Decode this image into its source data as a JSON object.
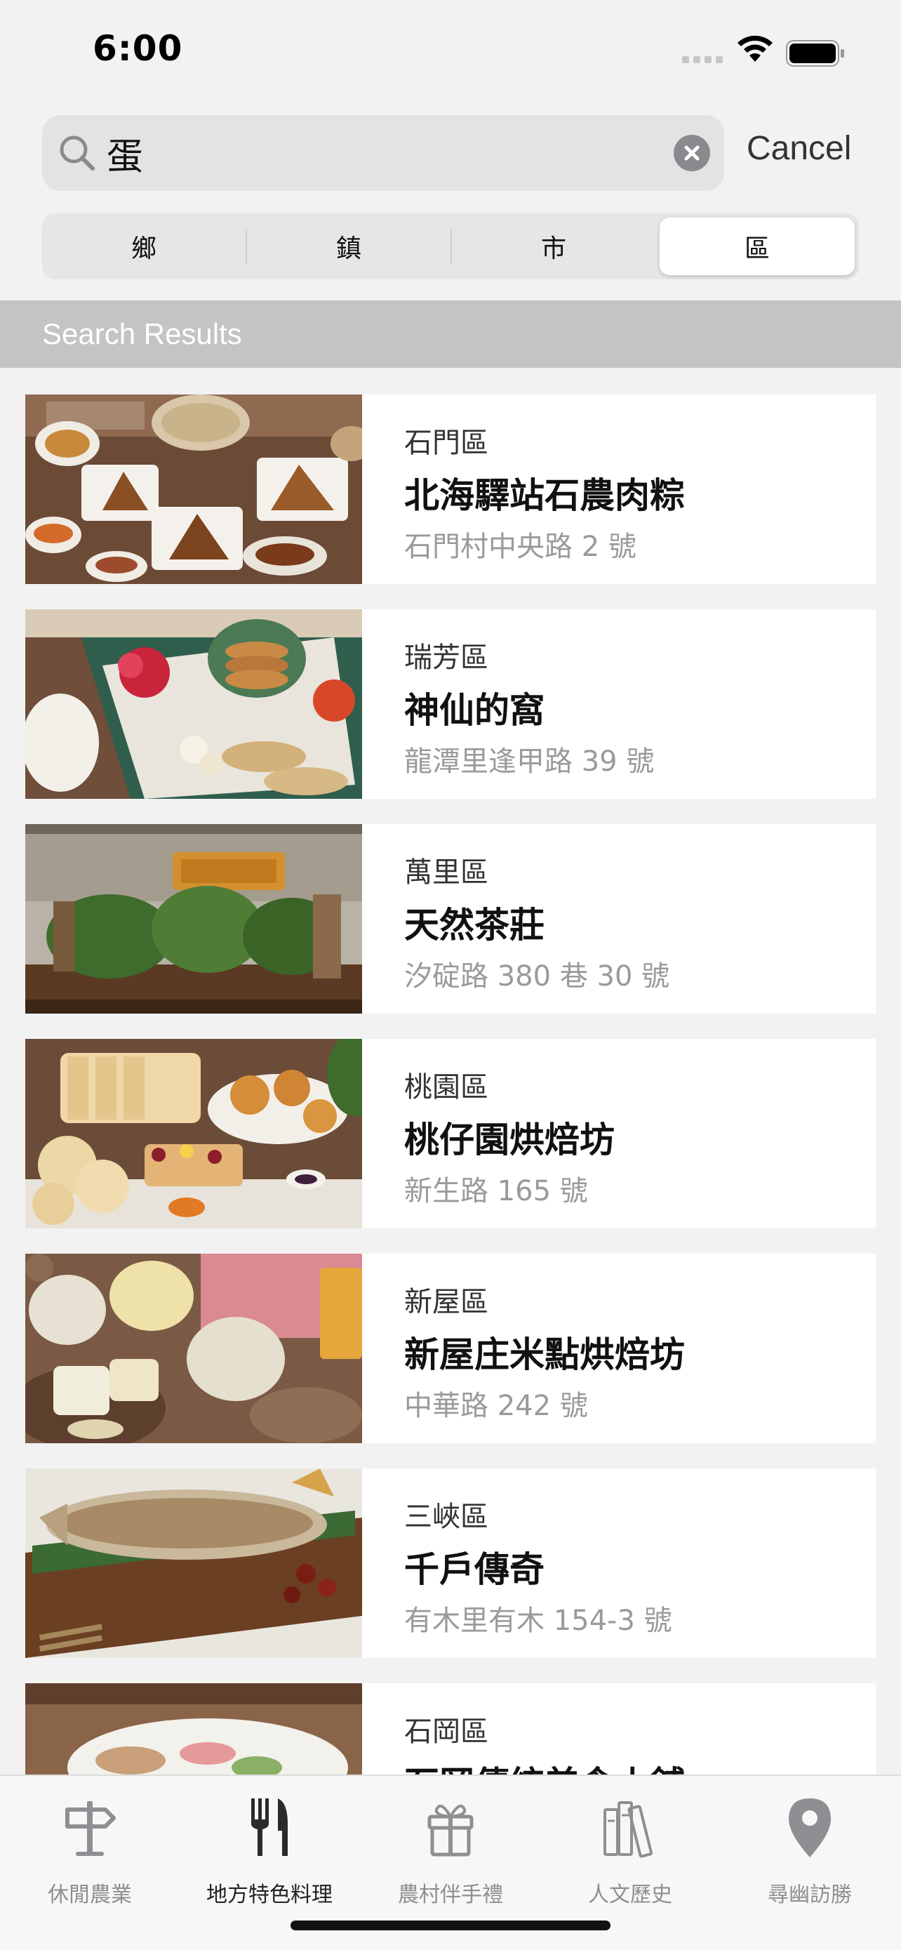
{
  "status_bar": {
    "time": "6:00"
  },
  "search": {
    "query": "蛋",
    "cancel_label": "Cancel"
  },
  "segments": [
    {
      "label": "鄉",
      "selected": false
    },
    {
      "label": "鎮",
      "selected": false
    },
    {
      "label": "市",
      "selected": false
    },
    {
      "label": "區",
      "selected": true
    }
  ],
  "results_header": "Search Results",
  "results": [
    {
      "district": "石門區",
      "name": "北海驛站石農肉粽",
      "address": "石門村中央路 2 號"
    },
    {
      "district": "瑞芳區",
      "name": "神仙的窩",
      "address": "龍潭里逢甲路 39 號"
    },
    {
      "district": "萬里區",
      "name": "天然茶莊",
      "address": "汐碇路 380 巷 30 號"
    },
    {
      "district": "桃園區",
      "name": "桃仔園烘焙坊",
      "address": "新生路 165 號"
    },
    {
      "district": "新屋區",
      "name": "新屋庄米點烘焙坊",
      "address": "中華路 242 號"
    },
    {
      "district": "三峽區",
      "name": "千戶傳奇",
      "address": "有木里有木 154-3 號"
    },
    {
      "district": "石岡區",
      "name": "石岡傳統美食小舖",
      "address": ""
    }
  ],
  "tabs": [
    {
      "label": "休閒農業",
      "icon": "signpost-icon",
      "active": false
    },
    {
      "label": "地方特色料理",
      "icon": "fork-knife-icon",
      "active": true
    },
    {
      "label": "農村伴手禮",
      "icon": "gift-icon",
      "active": false
    },
    {
      "label": "人文歷史",
      "icon": "books-icon",
      "active": false
    },
    {
      "label": "尋幽訪勝",
      "icon": "map-pin-icon",
      "active": false
    }
  ],
  "colors": {
    "background": "#f2f2f2",
    "header_bar": "#c4c4c4",
    "secondary_text": "#9a9a9a",
    "inactive_tab": "#8e8e93"
  }
}
